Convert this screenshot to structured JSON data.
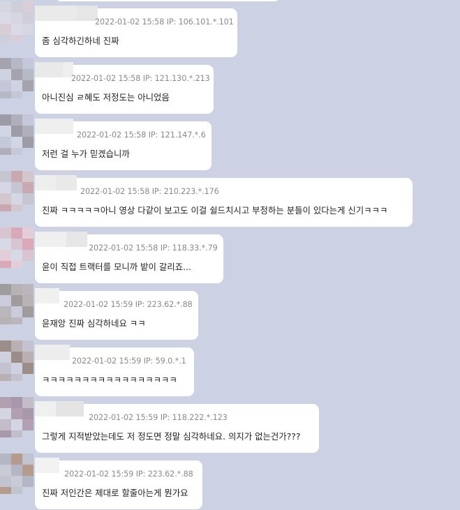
{
  "messages": [
    {
      "timestamp": "2022-01-02 15:58",
      "ip": "IP: 106.101.*.101",
      "text": "좀 심각하긴하네 진짜"
    },
    {
      "timestamp": "2022-01-02 15:58",
      "ip": "IP: 121.130.*.213",
      "text": "아니진심 ㄹ혜도 저정도는 아니었음"
    },
    {
      "timestamp": "2022-01-02 15:58",
      "ip": "IP: 121.147.*.6",
      "text": "저런 걸 누가 믿겠습니까"
    },
    {
      "timestamp": "2022-01-02 15:58",
      "ip": "IP: 210.223.*.176",
      "text": "진짜 ㅋㅋㅋㅋㅋ아니 영상 다같이 보고도 이걸 쉴드치시고 부정하는 분들이 있다는게 신기ㅋㅋㅋ"
    },
    {
      "timestamp": "2022-01-02 15:58",
      "ip": "IP: 118.33.*.79",
      "text": "윤이 직접 트랙터를 모니까 밭이 갈리죠..."
    },
    {
      "timestamp": "2022-01-02 15:59",
      "ip": "IP: 223.62.*.88",
      "text": "윤재앙 진짜 심각하네요 ㅋㅋ"
    },
    {
      "timestamp": "2022-01-02 15:59",
      "ip": "IP: 59.0.*.1",
      "text": "ㅋㅋㅋㅋㅋㅋㅋㅋㅋㅋㅋㅋㅋㅋㅋㅋㅋ"
    },
    {
      "timestamp": "2022-01-02 15:59",
      "ip": "IP: 118.222.*.123",
      "text": "그렇게 지적받았는데도 저 정도면 정말 심각하네요. 의지가 없는건가???"
    },
    {
      "timestamp": "2022-01-02 15:59",
      "ip": "IP: 223.62.*.88",
      "text": "진짜 저인간은 제대로 할줄아는게 뭔가요"
    }
  ],
  "colors": {
    "background": "#cdd1e4",
    "bubble": "#ffffff",
    "header_text": "#8a8a8a",
    "message_text": "#222222"
  }
}
